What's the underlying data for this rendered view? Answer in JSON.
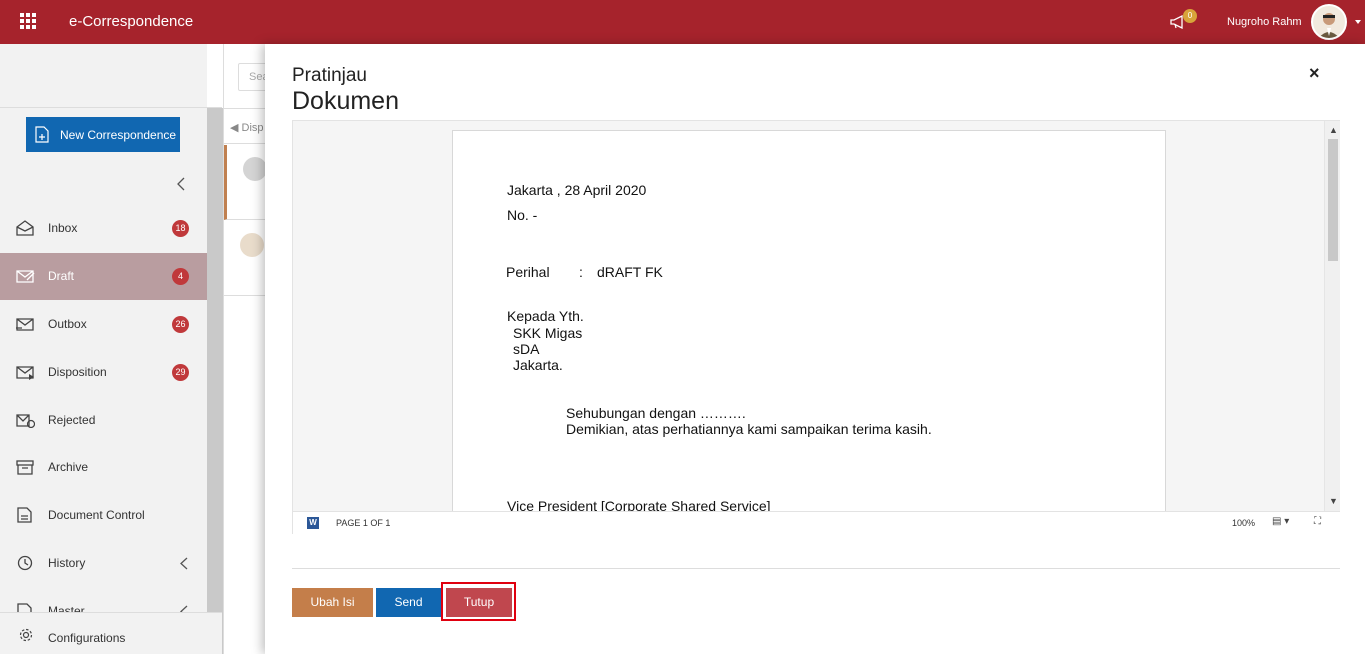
{
  "topbar": {
    "app_title": "e-Correspondence",
    "notification_count": "0",
    "user_name": "Nugroho Rahm"
  },
  "sidebar": {
    "new_button": "New Correspondence",
    "items": [
      {
        "label": "Inbox",
        "badge": "18"
      },
      {
        "label": "Draft",
        "badge": "4"
      },
      {
        "label": "Outbox",
        "badge": "26"
      },
      {
        "label": "Disposition",
        "badge": "29"
      },
      {
        "label": "Rejected"
      },
      {
        "label": "Archive"
      },
      {
        "label": "Document Control"
      },
      {
        "label": "History"
      },
      {
        "label": "Master"
      }
    ],
    "config_label": "Configurations"
  },
  "midcol": {
    "search_placeholder": "Sea",
    "tab_label": "Disp"
  },
  "modal": {
    "title_line1": "Pratinjau",
    "title_line2": "Dokumen",
    "close_label": "×"
  },
  "document": {
    "date_line": "Jakarta , 28 April 2020",
    "number_line": "No. -",
    "subject_label": "Perihal",
    "subject_colon": ":",
    "subject_value": "dRAFT FK",
    "to_line1": "Kepada Yth.",
    "to_line2": "SKK Migas",
    "to_line3": "sDA",
    "to_line4": "Jakarta.",
    "body_line1": "Sehubungan dengan ……….",
    "body_line2": "Demikian, atas perhatiannya kami sampaikan terima kasih.",
    "signature_line": "Vice President [Corporate Shared Service]"
  },
  "viewer": {
    "word_icon": "W",
    "page_info": "PAGE 1 OF 1",
    "zoom": "100%"
  },
  "buttons": {
    "ubah_isi": "Ubah Isi",
    "send": "Send",
    "tutup": "Tutup"
  }
}
